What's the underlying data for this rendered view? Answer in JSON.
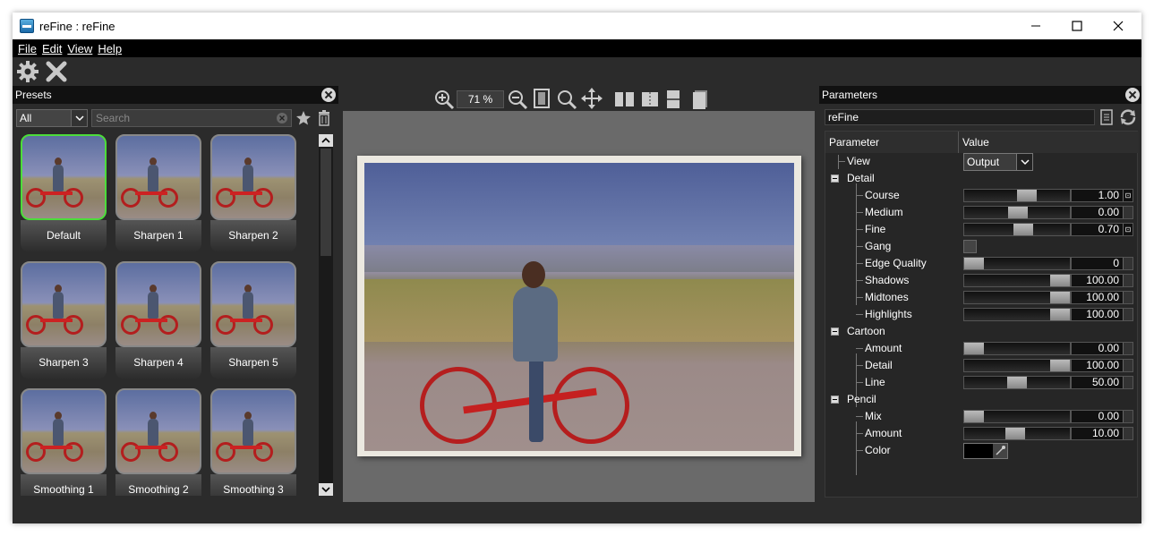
{
  "window": {
    "title": "reFine : reFine"
  },
  "menu": [
    "File",
    "Edit",
    "View",
    "Help"
  ],
  "toolbar": {
    "icons": [
      "gear-icon",
      "close-x-icon"
    ]
  },
  "presets": {
    "title": "Presets",
    "filter_value": "All",
    "search_placeholder": "Search",
    "items": [
      "Default",
      "Sharpen 1",
      "Sharpen 2",
      "Sharpen 3",
      "Sharpen 4",
      "Sharpen 5",
      "Smoothing 1",
      "Smoothing 2",
      "Smoothing 3"
    ],
    "selected": "Default",
    "selected_color": "#4cdd3a"
  },
  "viewer": {
    "zoom": "71 %"
  },
  "parameters": {
    "title": "Parameters",
    "preset_name": "reFine",
    "col_parameter": "Parameter",
    "col_value": "Value",
    "rows": {
      "view": {
        "label": "View",
        "value": "Output"
      },
      "detail": {
        "label": "Detail"
      },
      "course": {
        "label": "Course",
        "value": "1.00"
      },
      "medium": {
        "label": "Medium",
        "value": "0.00"
      },
      "fine": {
        "label": "Fine",
        "value": "0.70"
      },
      "gang": {
        "label": "Gang"
      },
      "edge_quality": {
        "label": "Edge Quality",
        "value": "0"
      },
      "shadows": {
        "label": "Shadows",
        "value": "100.00"
      },
      "midtones": {
        "label": "Midtones",
        "value": "100.00"
      },
      "highlights": {
        "label": "Highlights",
        "value": "100.00"
      },
      "cartoon": {
        "label": "Cartoon"
      },
      "cartoon_amount": {
        "label": "Amount",
        "value": "0.00"
      },
      "cartoon_detail": {
        "label": "Detail",
        "value": "100.00"
      },
      "cartoon_line": {
        "label": "Line",
        "value": "50.00"
      },
      "pencil": {
        "label": "Pencil"
      },
      "pencil_mix": {
        "label": "Mix",
        "value": "0.00"
      },
      "pencil_amount": {
        "label": "Amount",
        "value": "10.00"
      },
      "pencil_color": {
        "label": "Color",
        "value": "#000000"
      }
    }
  }
}
